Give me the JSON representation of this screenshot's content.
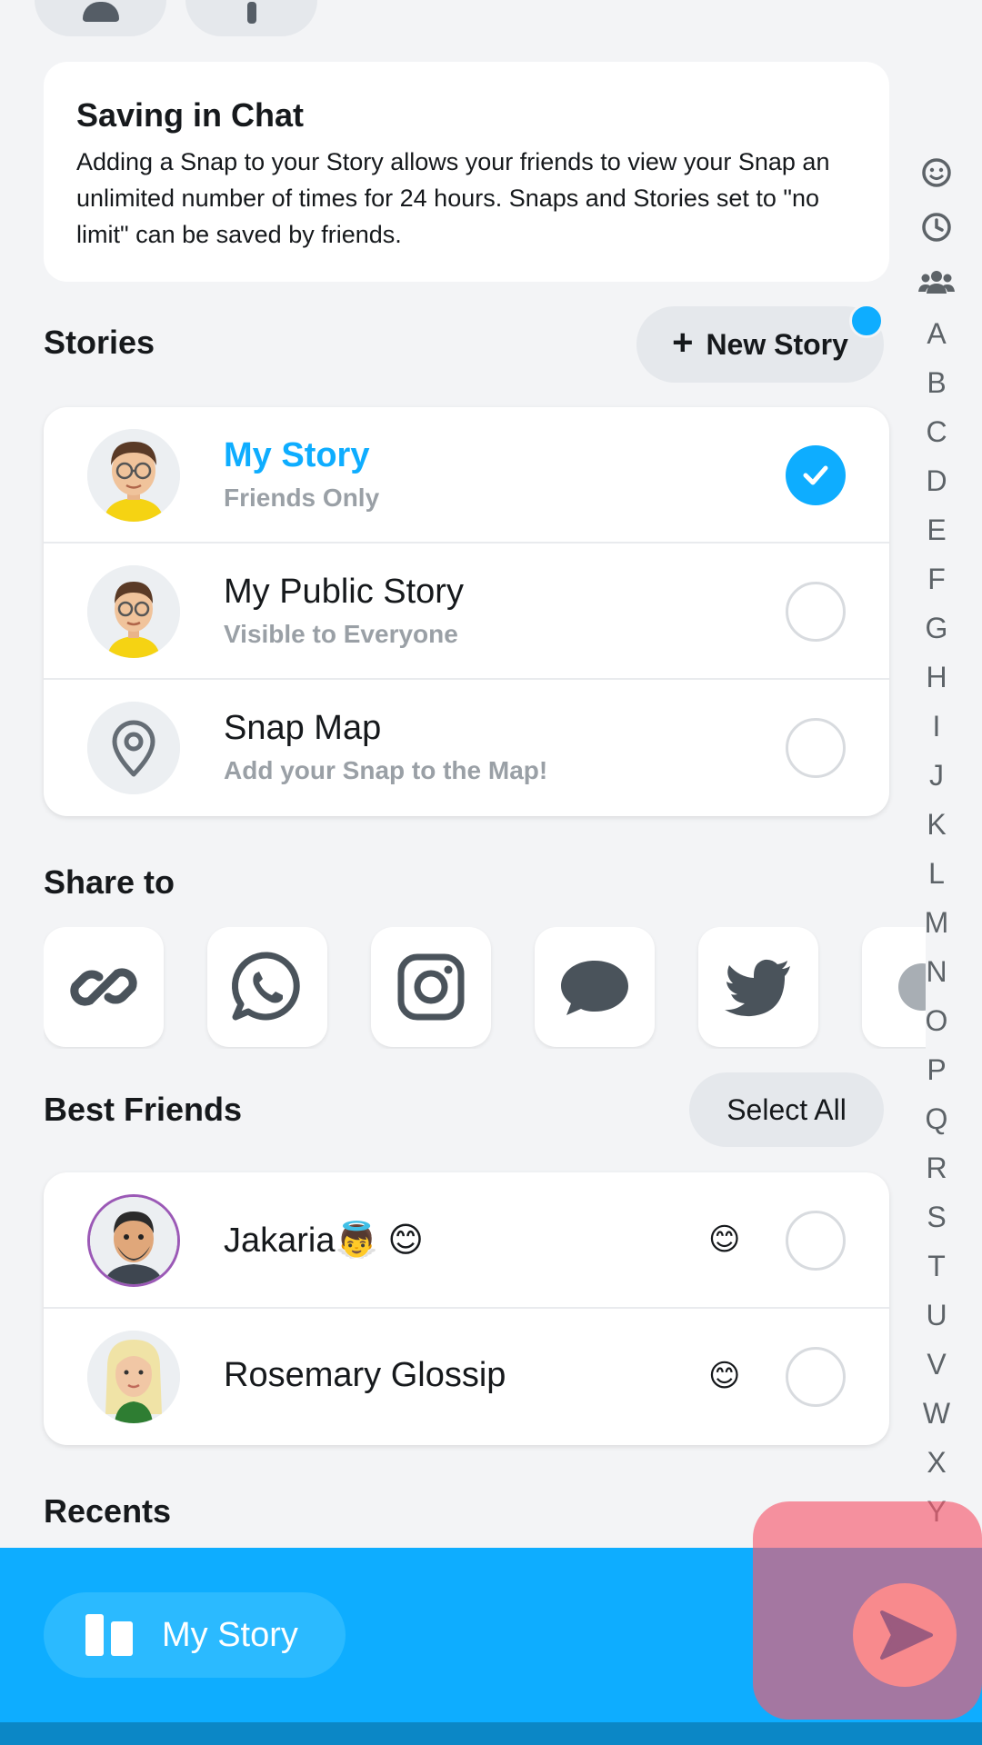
{
  "info": {
    "title": "Saving in Chat",
    "body": "Adding a Snap to your Story allows your friends to view your Snap an unlimited number of times for 24 hours. Snaps and Stories set to \"no limit\" can be saved by friends."
  },
  "stories": {
    "title": "Stories",
    "new_story_label": "New Story",
    "items": [
      {
        "title": "My Story",
        "subtitle": "Friends Only",
        "selected": true
      },
      {
        "title": "My Public Story",
        "subtitle": "Visible to Everyone",
        "selected": false
      },
      {
        "title": "Snap Map",
        "subtitle": "Add your Snap to the Map!",
        "selected": false
      }
    ]
  },
  "share": {
    "title": "Share to",
    "targets": [
      "link-icon",
      "whatsapp-icon",
      "instagram-icon",
      "messages-icon",
      "twitter-icon",
      "more-apps-icon"
    ]
  },
  "best_friends": {
    "title": "Best Friends",
    "select_all_label": "Select All",
    "items": [
      {
        "name": "Jakaria👼 😊",
        "emoji": "😊",
        "selected": false
      },
      {
        "name": "Rosemary Glossip",
        "emoji": "😊",
        "selected": false
      }
    ]
  },
  "recents": {
    "title": "Recents"
  },
  "alpha_index": {
    "icons": [
      "smiley-icon",
      "clock-icon",
      "group-icon"
    ],
    "letters": [
      "A",
      "B",
      "C",
      "D",
      "E",
      "F",
      "G",
      "H",
      "I",
      "J",
      "K",
      "L",
      "M",
      "N",
      "O",
      "P",
      "Q",
      "R",
      "S",
      "T",
      "U",
      "V",
      "W",
      "X",
      "Y"
    ]
  },
  "bottom_bar": {
    "chip_label": "My Story"
  },
  "colors": {
    "accent": "#0eadff",
    "background": "#f3f4f6",
    "highlight": "#f65a6e"
  }
}
